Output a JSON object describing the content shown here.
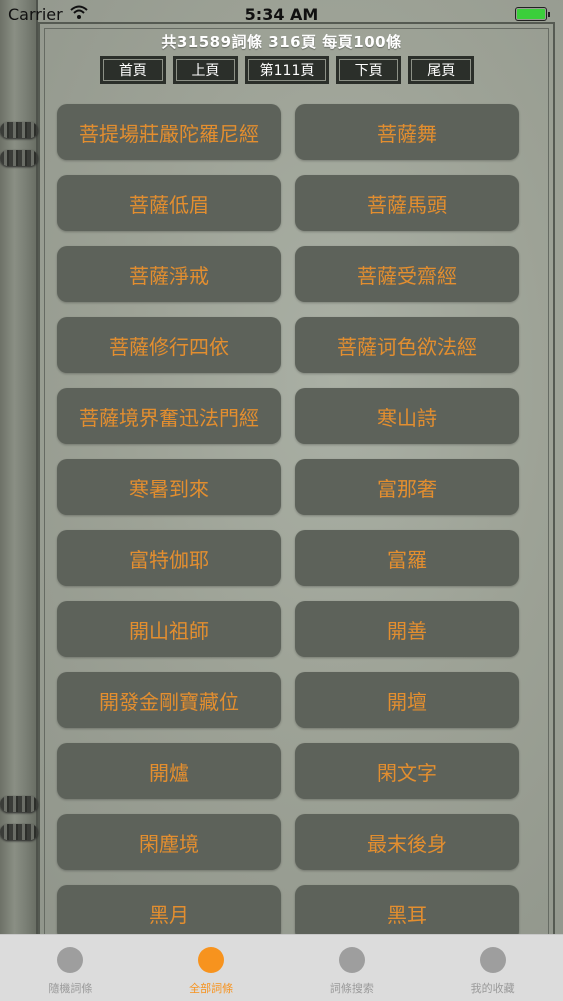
{
  "status_bar": {
    "carrier": "Carrier",
    "time": "5:34 AM",
    "battery_level": 1.0
  },
  "summary": "共31589詞條 316頁 每頁100條",
  "pager": {
    "first": "首頁",
    "prev": "上頁",
    "current": "第111頁",
    "next": "下頁",
    "last": "尾頁"
  },
  "terms": [
    "菩提場莊嚴陀羅尼經",
    "菩薩舞",
    "菩薩低眉",
    "菩薩馬頭",
    "菩薩淨戒",
    "菩薩受齋經",
    "菩薩修行四依",
    "菩薩诃色欲法經",
    "菩薩境界奮迅法門經",
    "寒山詩",
    "寒暑到來",
    "富那奢",
    "富特伽耶",
    "富羅",
    "開山祖師",
    "開善",
    "開發金剛寶藏位",
    "開壇",
    "開爐",
    "閑文字",
    "閑塵境",
    "最末後身",
    "黑月",
    "黑耳"
  ],
  "tabs": [
    {
      "label": "隨機詞條",
      "active": false
    },
    {
      "label": "全部詞條",
      "active": true
    },
    {
      "label": "詞條搜索",
      "active": false
    },
    {
      "label": "我的收藏",
      "active": false
    }
  ],
  "colors": {
    "term_text": "#e38e2f",
    "button_bg": "#5d625a",
    "active_tab": "#f7931e"
  }
}
